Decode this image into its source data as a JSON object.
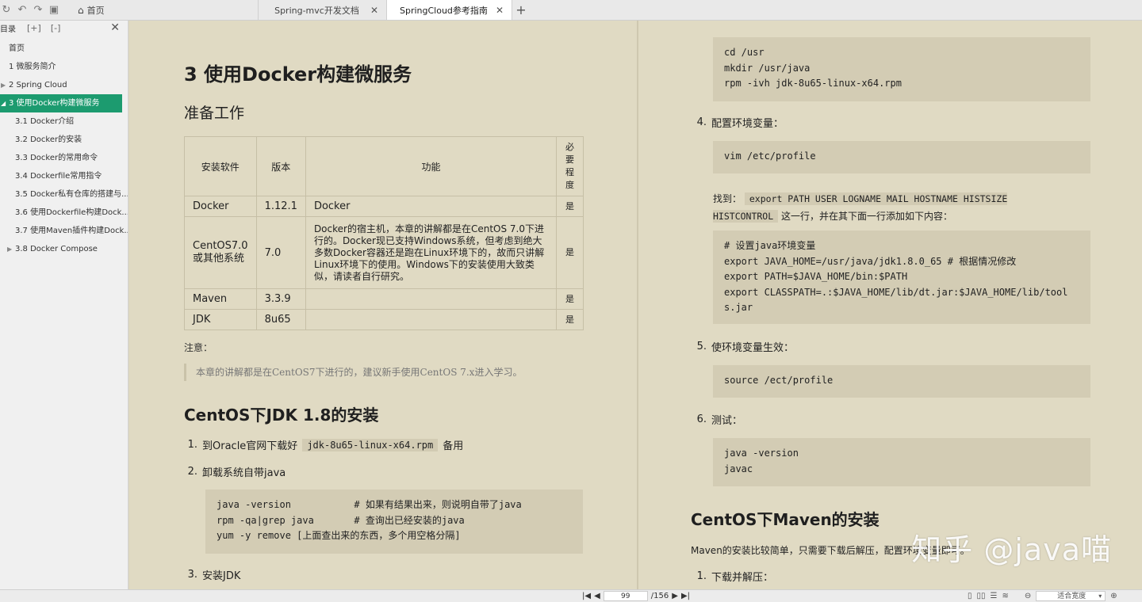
{
  "toolbar": {
    "icons": [
      "refresh-icon",
      "undo-icon",
      "redo-icon",
      "save-icon"
    ]
  },
  "tabs": [
    {
      "label": "首页",
      "icon": "home-icon"
    },
    {
      "label": "Spring-mvc开发文档"
    },
    {
      "label": "SpringCloud参考指南",
      "active": true
    }
  ],
  "sidebar": {
    "title": "目录",
    "items": [
      {
        "label": "首页",
        "level": 1,
        "expandable": false
      },
      {
        "label": "1 微服务简介",
        "level": 1,
        "expandable": false
      },
      {
        "label": "2 Spring Cloud",
        "level": 1,
        "expandable": true
      },
      {
        "label": "3 使用Docker构建微服务",
        "level": 1,
        "expandable": true,
        "active": true
      },
      {
        "label": "3.1 Docker介绍",
        "level": 2
      },
      {
        "label": "3.2 Docker的安装",
        "level": 2
      },
      {
        "label": "3.3 Docker的常用命令",
        "level": 2
      },
      {
        "label": "3.4 Dockerfile常用指令",
        "level": 2
      },
      {
        "label": "3.5 Docker私有仓库的搭建与...",
        "level": 2
      },
      {
        "label": "3.6 使用Dockerfile构建Dock...",
        "level": 2
      },
      {
        "label": "3.7 使用Maven插件构建Dock...",
        "level": 2
      },
      {
        "label": "3.8 Docker Compose",
        "level": 2,
        "expandable": true
      }
    ]
  },
  "left_page": {
    "title": "3 使用Docker构建微服务",
    "section1": "准备工作",
    "table": {
      "headers": [
        "安装软件",
        "版本",
        "功能",
        "必要程度"
      ],
      "rows": [
        [
          "Docker",
          "1.12.1",
          "Docker",
          "是"
        ],
        [
          "CentOS7.0或其他系统",
          "7.0",
          "Docker的宿主机，本章的讲解都是在CentOS 7.0下进行的。Docker现已支持Windows系统，但考虑到绝大多数Docker容器还是跑在Linux环境下的，故而只讲解Linux环境下的使用。Windows下的安装使用大致类似，请读者自行研究。",
          "是"
        ],
        [
          "Maven",
          "3.3.9",
          "",
          "是"
        ],
        [
          "JDK",
          "8u65",
          "",
          "是"
        ]
      ]
    },
    "note_label": "注意：",
    "note": "本章的讲解都是在CentOS7下进行的，建议新手使用CentOS 7.x进入学习。",
    "section2": "CentOS下JDK 1.8的安装",
    "step1": {
      "num": "1.",
      "pre": "到Oracle官网下载好",
      "code": "jdk-8u65-linux-x64.rpm",
      "post": "备用"
    },
    "step2": {
      "num": "2.",
      "text": "卸载系统自带java"
    },
    "code1": "java -version           # 如果有结果出来，则说明自带了java\nrpm -qa|grep java       # 查询出已经安装的java\nyum -y remove [上面查出来的东西，多个用空格分隔]",
    "step3": {
      "num": "3.",
      "text": "安装JDK"
    }
  },
  "right_page": {
    "code_top": "cd /usr\nmkdir /usr/java\nrpm -ivh jdk-8u65-linux-x64.rpm",
    "step4": {
      "num": "4.",
      "text": "配置环境变量："
    },
    "code_vim": "vim /etc/profile",
    "find": {
      "pre": "找到：",
      "code": "export PATH USER LOGNAME MAIL HOSTNAME HISTSIZE HISTCONTROL",
      "post": "这一行，并在其下面一行添加如下内容："
    },
    "code_env": "# 设置java环境变量\nexport JAVA_HOME=/usr/java/jdk1.8.0_65 # 根据情况修改\nexport PATH=$JAVA_HOME/bin:$PATH\nexport CLASSPATH=.:$JAVA_HOME/lib/dt.jar:$JAVA_HOME/lib/tool\ns.jar",
    "step5": {
      "num": "5.",
      "text": "使环境变量生效："
    },
    "code_source": "source /ect/profile",
    "step6": {
      "num": "6.",
      "text": "测试："
    },
    "code_test": "java -version\njavac",
    "section3": "CentOS下Maven的安装",
    "maven_intro": "Maven的安装比较简单，只需要下载后解压，配置环境变量即可。",
    "step_m1": {
      "num": "1.",
      "text": "下载并解压："
    }
  },
  "watermark": "知乎 @java喵",
  "statusbar": {
    "current_page": "99",
    "total_pages": "/156",
    "zoom_label": "适合宽度"
  }
}
